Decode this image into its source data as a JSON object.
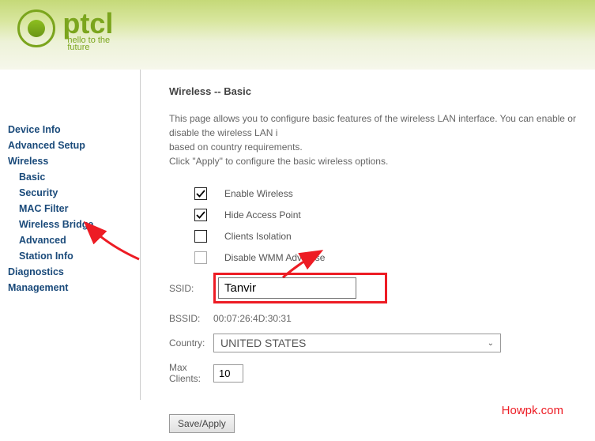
{
  "logo": {
    "brand": "ptcl",
    "tagline1": "hello to the",
    "tagline2": "future"
  },
  "sidebar": {
    "items": [
      {
        "label": "Device Info"
      },
      {
        "label": "Advanced Setup"
      },
      {
        "label": "Wireless"
      },
      {
        "label": "Basic"
      },
      {
        "label": "Security"
      },
      {
        "label": "MAC Filter"
      },
      {
        "label": "Wireless Bridge"
      },
      {
        "label": "Advanced"
      },
      {
        "label": "Station Info"
      },
      {
        "label": "Diagnostics"
      },
      {
        "label": "Management"
      }
    ]
  },
  "page": {
    "title": "Wireless -- Basic",
    "descLine1": "This page allows you to configure basic features of the wireless LAN interface. You can enable or disable the wireless LAN i",
    "descLine2": "based on country requirements.",
    "descLine3": "Click \"Apply\" to configure the basic wireless options."
  },
  "options": {
    "enableWireless": {
      "label": "Enable Wireless",
      "checked": true
    },
    "hideAP": {
      "label": "Hide Access Point",
      "checked": true
    },
    "clientsIsolation": {
      "label": "Clients Isolation",
      "checked": false
    },
    "disableWMM": {
      "label": "Disable WMM Advertise",
      "checked": false,
      "disabled": true
    }
  },
  "fields": {
    "ssidLabel": "SSID:",
    "ssidValue": "Tanvir",
    "bssidLabel": "BSSID:",
    "bssidValue": "00:07:26:4D:30:31",
    "countryLabel": "Country:",
    "countryValue": "UNITED STATES",
    "maxLabel1": "Max",
    "maxLabel2": "Clients:",
    "maxValue": "10"
  },
  "buttons": {
    "saveApply": "Save/Apply"
  },
  "watermark": "Howpk.com"
}
